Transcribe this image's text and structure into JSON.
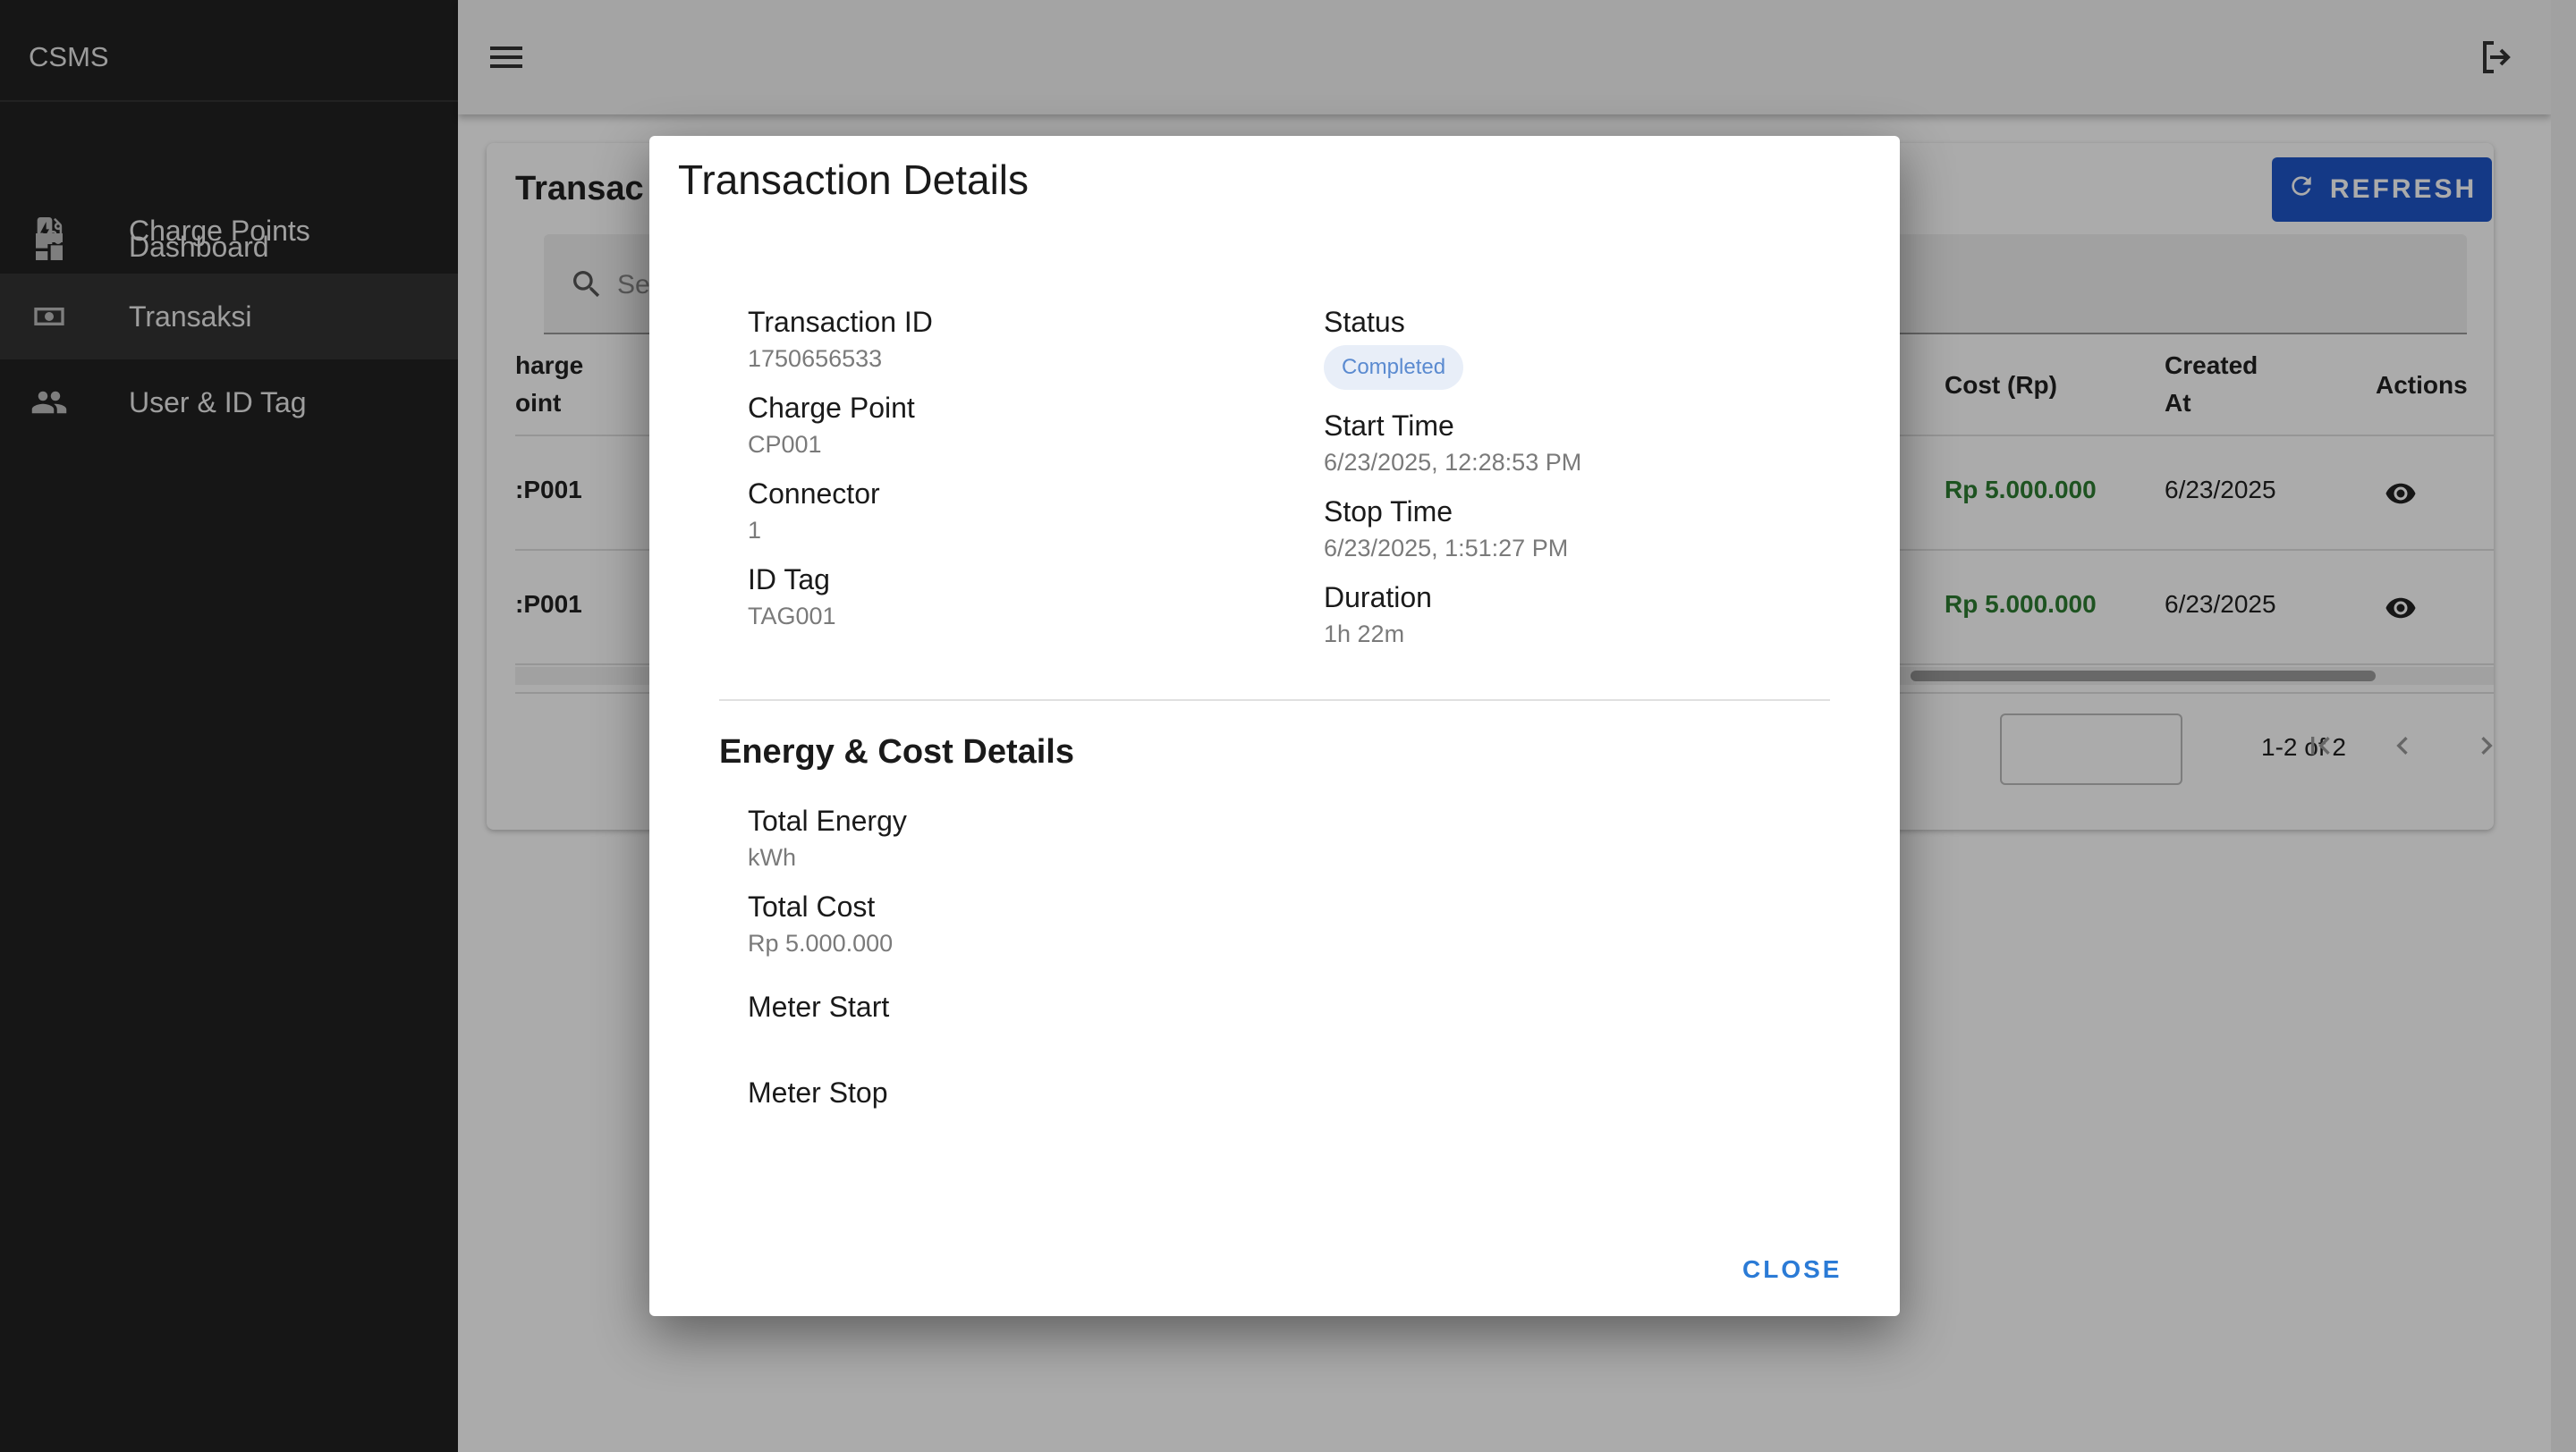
{
  "app": {
    "brand": "CSMS"
  },
  "sidebar": {
    "items": [
      {
        "label": "Dashboard",
        "icon": "dashboard-icon"
      },
      {
        "label": "Charge Points",
        "icon": "ev-station-icon"
      },
      {
        "label": "Transaksi",
        "icon": "money-icon",
        "active": true
      },
      {
        "label": "User & ID Tag",
        "icon": "people-icon"
      }
    ]
  },
  "page": {
    "title": "Transac",
    "refresh_label": "REFRESH",
    "search_placeholder": "Se"
  },
  "table": {
    "headers": {
      "charge_point": [
        "harge",
        "oint"
      ],
      "cost": "Cost (Rp)",
      "created_at": [
        "Created",
        "At"
      ],
      "actions": "Actions"
    },
    "rows": [
      {
        "charge_point": ":P001",
        "cost": "Rp 5.000.000",
        "created_at": "6/23/2025"
      },
      {
        "charge_point": ":P001",
        "cost": "Rp 5.000.000",
        "created_at": "6/23/2025"
      }
    ],
    "pagination": {
      "info": "1-2 of 2"
    }
  },
  "dialog": {
    "title": "Transaction Details",
    "left_fields": [
      {
        "label": "Transaction ID",
        "value": "1750656533"
      },
      {
        "label": "Charge Point",
        "value": "CP001"
      },
      {
        "label": "Connector",
        "value": "1"
      },
      {
        "label": "ID Tag",
        "value": "TAG001"
      }
    ],
    "status": {
      "label": "Status",
      "value": "Completed"
    },
    "right_fields": [
      {
        "label": "Start Time",
        "value": "6/23/2025, 12:28:53 PM"
      },
      {
        "label": "Stop Time",
        "value": "6/23/2025, 1:51:27 PM"
      },
      {
        "label": "Duration",
        "value": "1h 22m"
      }
    ],
    "energy_section": {
      "title": "Energy & Cost Details",
      "fields": [
        {
          "label": "Total Energy",
          "value": "kWh"
        },
        {
          "label": "Total Cost",
          "value": "Rp 5.000.000"
        },
        {
          "label": "Meter Start",
          "value": ""
        },
        {
          "label": "Meter Stop",
          "value": ""
        }
      ]
    },
    "close_label": "CLOSE"
  },
  "colors": {
    "sidebar_bg": "#212121",
    "primary": "#1e56c8",
    "cost_green": "#2e7d32",
    "link_blue": "#2b7bd6"
  }
}
